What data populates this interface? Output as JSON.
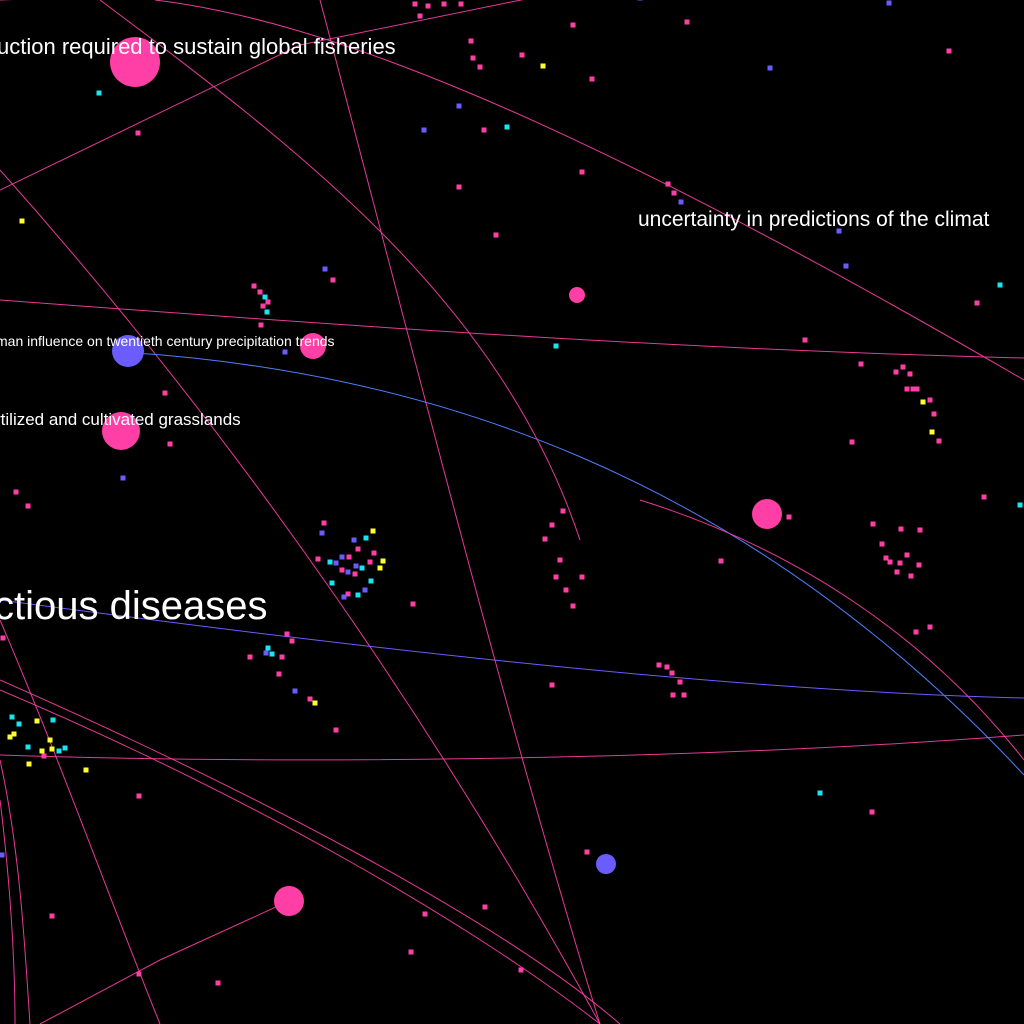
{
  "labels": {
    "fisheries": "uction required to sustain global fisheries",
    "climate": "uncertainty in predictions of the climat",
    "precipitation": "man influence on twentieth century precipitation trends",
    "grasslands": "rtilized and cultivated grasslands",
    "diseases": "ctious diseases"
  },
  "colors": {
    "background": "#000000",
    "magenta": "#ff3fa6",
    "violet": "#6b5cff",
    "blue": "#4f7dff",
    "cyan": "#19e5f2",
    "yellow": "#ffff2e",
    "label": "#ffffff"
  }
}
